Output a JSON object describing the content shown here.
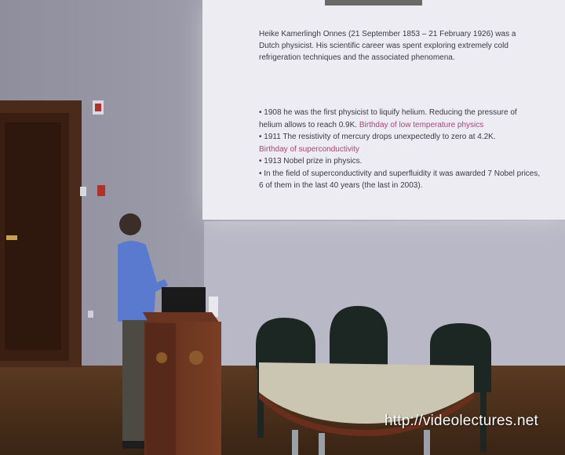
{
  "slide": {
    "intro": "Heike Kamerlingh Onnes (21 September 1853 – 21 February 1926) was a Dutch physicist. His scientific career was spent exploring extremely cold refrigeration techniques and the associated phenomena.",
    "bullet1_a": "• 1908 he was the first physicist to liquify helium. Reducing the pressure of helium allows to reach 0.9K.",
    "bullet1_hl": "Birthday of low temperature physics",
    "bullet2_a": "• 1911 The resistivity of mercury drops unexpectedly to zero at 4.2K.",
    "bullet2_hl": "Birthday of superconductivity",
    "bullet3": "• 1913 Nobel prize in physics.",
    "bullet4": "• In the field of superconductivity and superfluidity it was awarded 7 Nobel prices, 6 of them in the last 40 years (the last in 2003)."
  },
  "watermark": "http://videolectures.net"
}
